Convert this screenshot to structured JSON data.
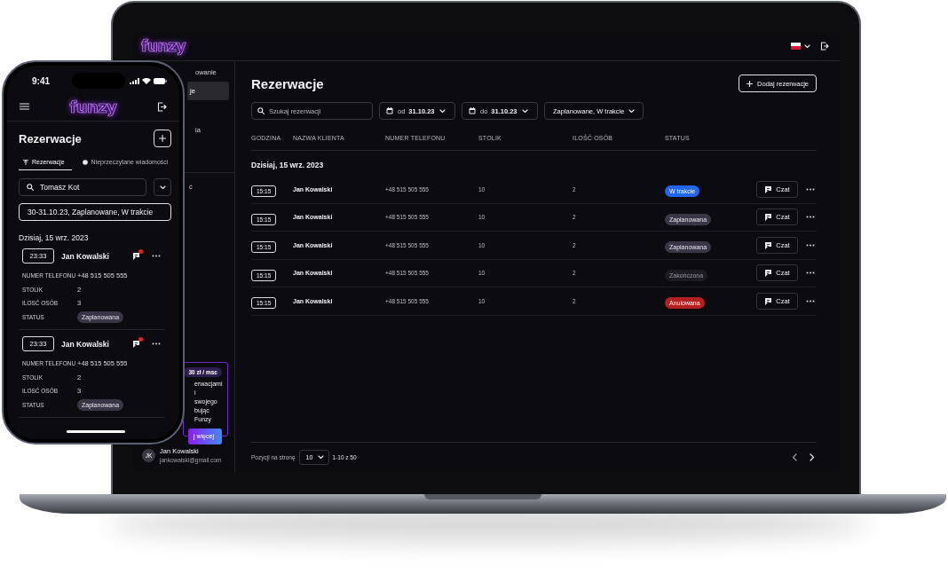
{
  "laptop": {
    "app_bar": {
      "logo": "funzy"
    },
    "sidebar": {
      "items": [
        {
          "label": "owanie",
          "selected": false
        },
        {
          "label": "je",
          "selected": true
        },
        {
          "label": "ia",
          "selected": false
        }
      ],
      "section_2_items": [
        {
          "label": "ć",
          "selected": false
        }
      ],
      "promo": {
        "price": "30 zł / msc",
        "text": "erwacjami i\nswojego\nbując Funzy",
        "button": "j więcej"
      },
      "user": {
        "initials": "JK",
        "name": "Jan Kowalski",
        "email": "jankowalski@gmail.com"
      }
    },
    "page": {
      "title": "Rezerwacje",
      "add_button": "Dodaj rezerwacje",
      "search": {
        "placeholder": "Szukaj rezerwacji"
      },
      "date_from": {
        "prefix": "od",
        "value": "31.10.23"
      },
      "date_to": {
        "prefix": "do",
        "value": "31.10.23"
      },
      "status_filter": "Zaplanowane, W trakcie",
      "table": {
        "columns": [
          "GODZINA",
          "NAZWA KLIENTA",
          "NUMER TELEFONU",
          "STOLIK",
          "ILOŚĆ OSÓB",
          "STATUS"
        ],
        "group": "Dzisiaj, 15 wrz. 2023",
        "rows": [
          {
            "time": "15:15",
            "client": "Jan Kowalski",
            "phone": "+48 515 505 555",
            "table": "10",
            "guests": "2",
            "status": {
              "label": "W trakcie",
              "kind": "active"
            },
            "chat_button": "Czat"
          },
          {
            "time": "15:15",
            "client": "Jan Kowalski",
            "phone": "+48 515 505 555",
            "table": "10",
            "guests": "2",
            "status": {
              "label": "Zaplanowana",
              "kind": "planned"
            },
            "chat_button": "Czat"
          },
          {
            "time": "15:15",
            "client": "Jan Kowalski",
            "phone": "+48 515 505 555",
            "table": "10",
            "guests": "2",
            "status": {
              "label": "Zaplanowana",
              "kind": "planned"
            },
            "chat_button": "Czat"
          },
          {
            "time": "15:15",
            "client": "Jan Kowalski",
            "phone": "+48 515 505 555",
            "table": "10",
            "guests": "2",
            "status": {
              "label": "Zakończona",
              "kind": "finished"
            },
            "chat_button": "Czat"
          },
          {
            "time": "15:15",
            "client": "Jan Kowalski",
            "phone": "+48 515 505 555",
            "table": "10",
            "guests": "2",
            "status": {
              "label": "Anulowana",
              "kind": "cancelled"
            },
            "chat_button": "Czat"
          }
        ]
      },
      "pagination": {
        "label": "Pozycji na stronę",
        "page_size": "10",
        "range": "1-10 z 50"
      }
    }
  },
  "phone": {
    "status_bar": {
      "time": "9:41"
    },
    "app_bar": {
      "logo": "funzy"
    },
    "title": "Rezerwacje",
    "tabs": [
      {
        "label": "Rezerwacje",
        "selected": true
      },
      {
        "label": "Nieprzeczytane wiadomości",
        "selected": false
      }
    ],
    "search": {
      "value": "Tomasz Kot"
    },
    "filter": "30-31.10.23, Zaplanowane, W trakcie",
    "group": "Dzisiaj, 15 wrz. 2023",
    "cards": [
      {
        "time": "23:33",
        "client": "Jan Kowalski",
        "unread": true,
        "fields": [
          {
            "label": "NUMER TELEFONU",
            "value": "+48 515 505 555"
          },
          {
            "label": "STOLIK",
            "value": "2"
          },
          {
            "label": "ILOSĆ OSÓB",
            "value": "3"
          }
        ],
        "status": {
          "label": "STATUS",
          "value": "Zaplanowana",
          "kind": "planned"
        }
      },
      {
        "time": "23:33",
        "client": "Jan Kowalski",
        "unread": true,
        "fields": [
          {
            "label": "NUMER TELEFONU",
            "value": "+48 515 505 555"
          },
          {
            "label": "STOLIK",
            "value": "2"
          },
          {
            "label": "ILOSĆ OSÓB",
            "value": "3"
          }
        ],
        "status": {
          "label": "STATUS",
          "value": "Zaplanowana",
          "kind": "planned"
        }
      }
    ]
  }
}
